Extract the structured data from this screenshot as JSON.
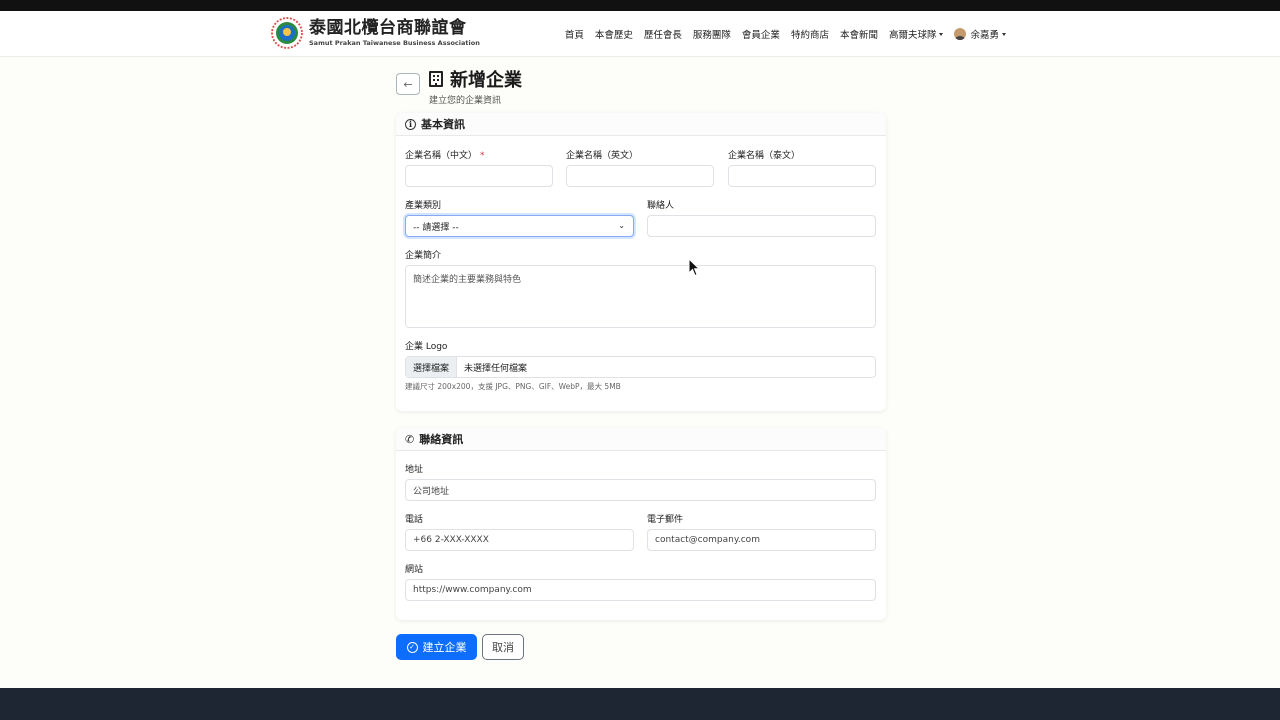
{
  "navbar": {
    "brand_zh": "泰國北欖台商聯誼會",
    "brand_en": "Samut Prakan Taiwanese Business Association",
    "items": [
      "首頁",
      "本會歷史",
      "歷任會長",
      "服務團隊",
      "會員企業",
      "特約商店",
      "本會新聞"
    ],
    "golf_label": "高爾夫球隊",
    "user_name": "余嘉勇"
  },
  "page": {
    "title": "新增企業",
    "subtitle": "建立您的企業資訊"
  },
  "basic": {
    "heading": "基本資訊",
    "name_zh_label": "企業名稱（中文）",
    "required_mark": "*",
    "name_en_label": "企業名稱（英文）",
    "name_th_label": "企業名稱（泰文）",
    "industry_label": "產業類別",
    "industry_value": "-- 請選擇 --",
    "contact_label": "聯絡人",
    "intro_label": "企業簡介",
    "intro_placeholder": "簡述企業的主要業務與特色",
    "logo_label": "企業 Logo",
    "file_button": "選擇檔案",
    "file_status": "未選擇任何檔案",
    "logo_hint": "建議尺寸 200x200，支援 JPG、PNG、GIF、WebP，最大 5MB"
  },
  "contact": {
    "heading": "聯絡資訊",
    "address_label": "地址",
    "address_placeholder": "公司地址",
    "phone_label": "電話",
    "phone_placeholder": "+66 2-XXX-XXXX",
    "email_label": "電子郵件",
    "email_placeholder": "contact@company.com",
    "website_label": "網站",
    "website_placeholder": "https://www.company.com"
  },
  "actions": {
    "submit": "建立企業",
    "cancel": "取消"
  },
  "colors": {
    "primary": "#0d6efd",
    "footer": "#1f2633"
  }
}
